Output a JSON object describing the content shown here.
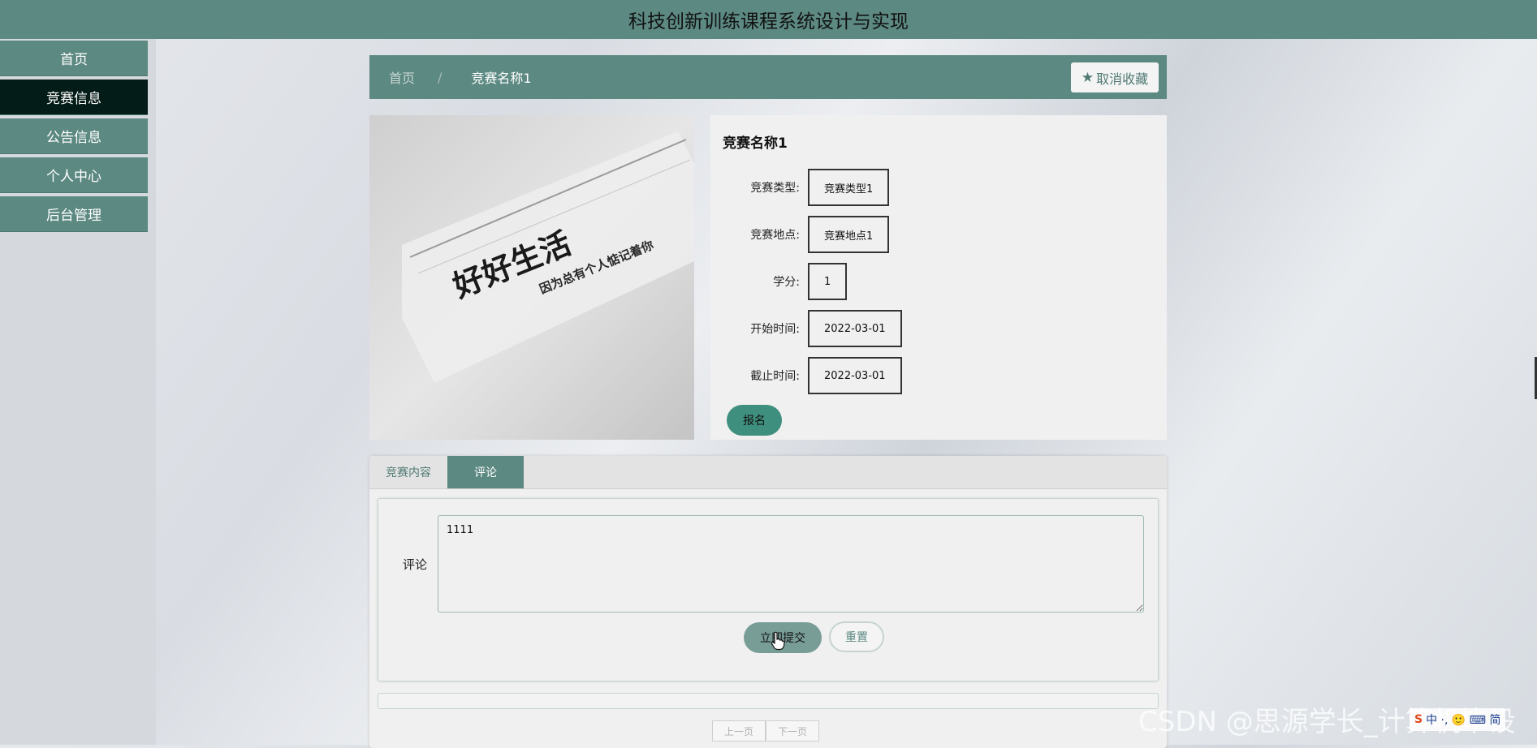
{
  "header": {
    "title": "科技创新训练课程系统设计与实现"
  },
  "sidebar": {
    "items": [
      {
        "label": "首页"
      },
      {
        "label": "竞赛信息"
      },
      {
        "label": "公告信息"
      },
      {
        "label": "个人中心"
      },
      {
        "label": "后台管理"
      }
    ],
    "active_index": 1
  },
  "breadcrumb": {
    "home": "首页",
    "separator": "/",
    "current": "竞赛名称1"
  },
  "favorite_button": {
    "label": "取消收藏",
    "icon": "star-icon"
  },
  "photo": {
    "text_main": "好好生活",
    "text_sub": "因为总有个人惦记着你"
  },
  "details": {
    "title": "竞赛名称1",
    "fields": [
      {
        "label": "竞赛类型:",
        "value": "竞赛类型1"
      },
      {
        "label": "竞赛地点:",
        "value": "竞赛地点1"
      },
      {
        "label": "学分:",
        "value": "1"
      },
      {
        "label": "开始时间:",
        "value": "2022-03-01"
      },
      {
        "label": "截止时间:",
        "value": "2022-03-01"
      }
    ],
    "signup_label": "报名"
  },
  "tabs": [
    {
      "label": "竞赛内容",
      "active": false
    },
    {
      "label": "评论",
      "active": true
    }
  ],
  "comment": {
    "label": "评论",
    "value": "1111",
    "submit_label": "立即提交",
    "reset_label": "重置"
  },
  "pager": {
    "prev": "上一页",
    "next": "下一页"
  },
  "watermark": {
    "text": "CSDN @思源学长_计算机毕设"
  },
  "ime": {
    "text": "中 ·, 🙂 ⌨ 简",
    "logo": "S"
  },
  "colors": {
    "primary": "#5c8982",
    "active_nav": "#041c17",
    "signup": "#3f8f7e"
  }
}
